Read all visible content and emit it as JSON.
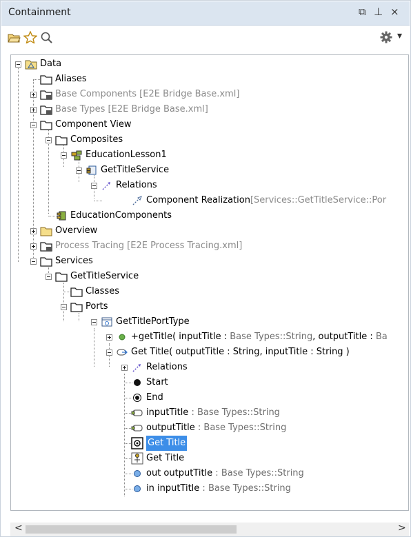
{
  "panel": {
    "title": "Containment",
    "controls": [
      "⧉",
      "⊥",
      "×"
    ]
  },
  "toolbar": {
    "icons": [
      "open-folder-icon",
      "star-icon",
      "search-icon",
      "gear-icon",
      "dropdown-arrow-icon"
    ],
    "menu_arrow": "▾"
  },
  "tree": {
    "data": "Data",
    "aliases": "Aliases",
    "base_components": "Base Components [E2E Bridge Base.xml]",
    "base_types": "Base Types [E2E Bridge Base.xml]",
    "component_view": "Component View",
    "composites": "Composites",
    "education_lesson": "EducationLesson1",
    "get_title_service_component": "GetTitleService",
    "relations_1": "Relations",
    "component_realization": "Component Realization",
    "component_realization_path": "[Services::GetTitleService::Por",
    "education_components": "EducationComponents",
    "overview": "Overview",
    "process_tracing": "Process Tracing [E2E Process Tracing.xml]",
    "services": "Services",
    "get_title_service": "GetTitleService",
    "classes": "Classes",
    "ports": "Ports",
    "port_type": "GetTitlePortType",
    "op_getTitle": "+getTitle( inputTitle : ",
    "op_getTitle_t1": "Base Types::String",
    "op_getTitle_p2": ", outputTitle : ",
    "op_getTitle_t2": "Ba",
    "activity": "Get Title( outputTitle : String, inputTitle : String )",
    "relations_2": "Relations",
    "start": "Start",
    "end": "End",
    "input_title": "inputTitle",
    "input_title_type": " : Base Types::String",
    "output_title": "outputTitle",
    "output_title_type": " : Base Types::String",
    "get_title_selected": "Get Title",
    "get_title_2": "Get Title",
    "out_param": "out outputTitle",
    "out_param_type": " : Base Types::String",
    "in_param": "in inputTitle",
    "in_param_type": " : Base Types::String"
  },
  "scrollbar": {
    "left_arrow": "<",
    "right_arrow": ">"
  }
}
